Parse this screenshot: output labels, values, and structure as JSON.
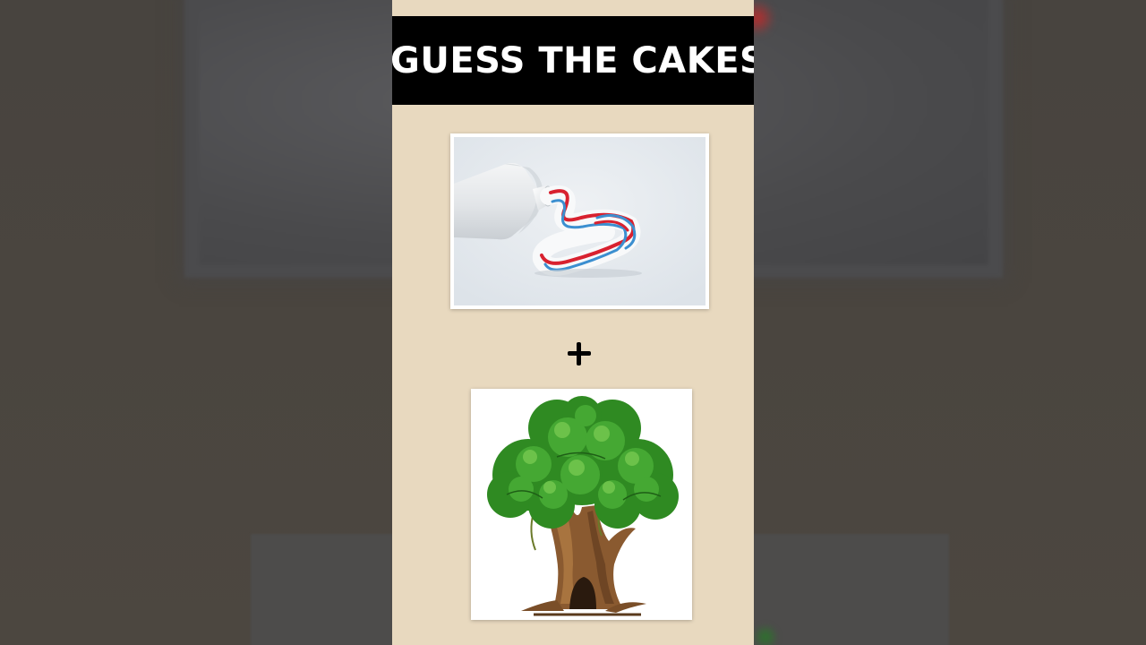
{
  "title": "GUESS THE CAKES",
  "clues": [
    {
      "subject": "toothpaste",
      "icon": "toothpaste-icon"
    },
    {
      "subject": "tree",
      "icon": "tree-icon"
    }
  ],
  "operator": "+",
  "colors": {
    "frame_background": "#e8d9bf",
    "title_bar": "#000000",
    "title_text": "#ffffff",
    "backdrop": "#4a4540"
  }
}
